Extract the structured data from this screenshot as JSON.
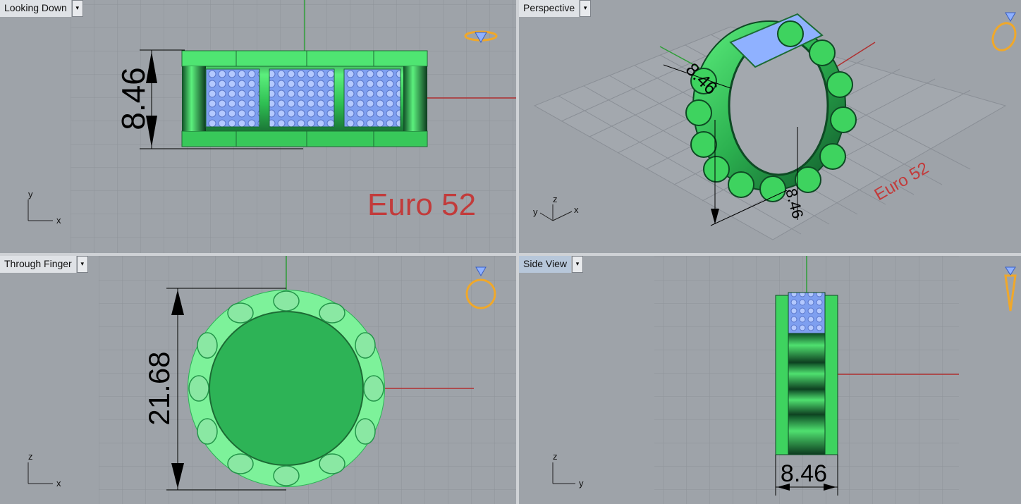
{
  "viewports": {
    "top_left": {
      "label": "Looking Down",
      "dimension": "8.46",
      "annotation": "Euro 52",
      "axes": {
        "vertical": "y",
        "horizontal": "x"
      },
      "icon": "ring-top-icon"
    },
    "top_right": {
      "label": "Perspective",
      "dimension_a": "8.46",
      "dimension_b": "8.46",
      "annotation": "Euro 52",
      "axes": {
        "vertical": "z",
        "left": "y",
        "right": "x"
      },
      "icon": "ring-perspective-icon"
    },
    "bottom_left": {
      "label": "Through Finger",
      "dimension": "21.68",
      "axes": {
        "vertical": "z",
        "horizontal": "x"
      },
      "icon": "ring-front-icon"
    },
    "bottom_right": {
      "label": "Side View",
      "dimension": "8.46",
      "axes": {
        "vertical": "z",
        "horizontal": "y"
      },
      "icon": "ring-side-icon"
    }
  },
  "dropdown_glyph": "▾",
  "colors": {
    "viewport_bg": "#9ea3a9",
    "grid": "#8f949b",
    "axis_x": "#b03030",
    "axis_y": "#2f9e38",
    "ring_green": "#3ed35f",
    "gem_blue": "#8fb1ff",
    "annotation_red": "#c23b3b",
    "icon_gold": "#f0a82a"
  }
}
